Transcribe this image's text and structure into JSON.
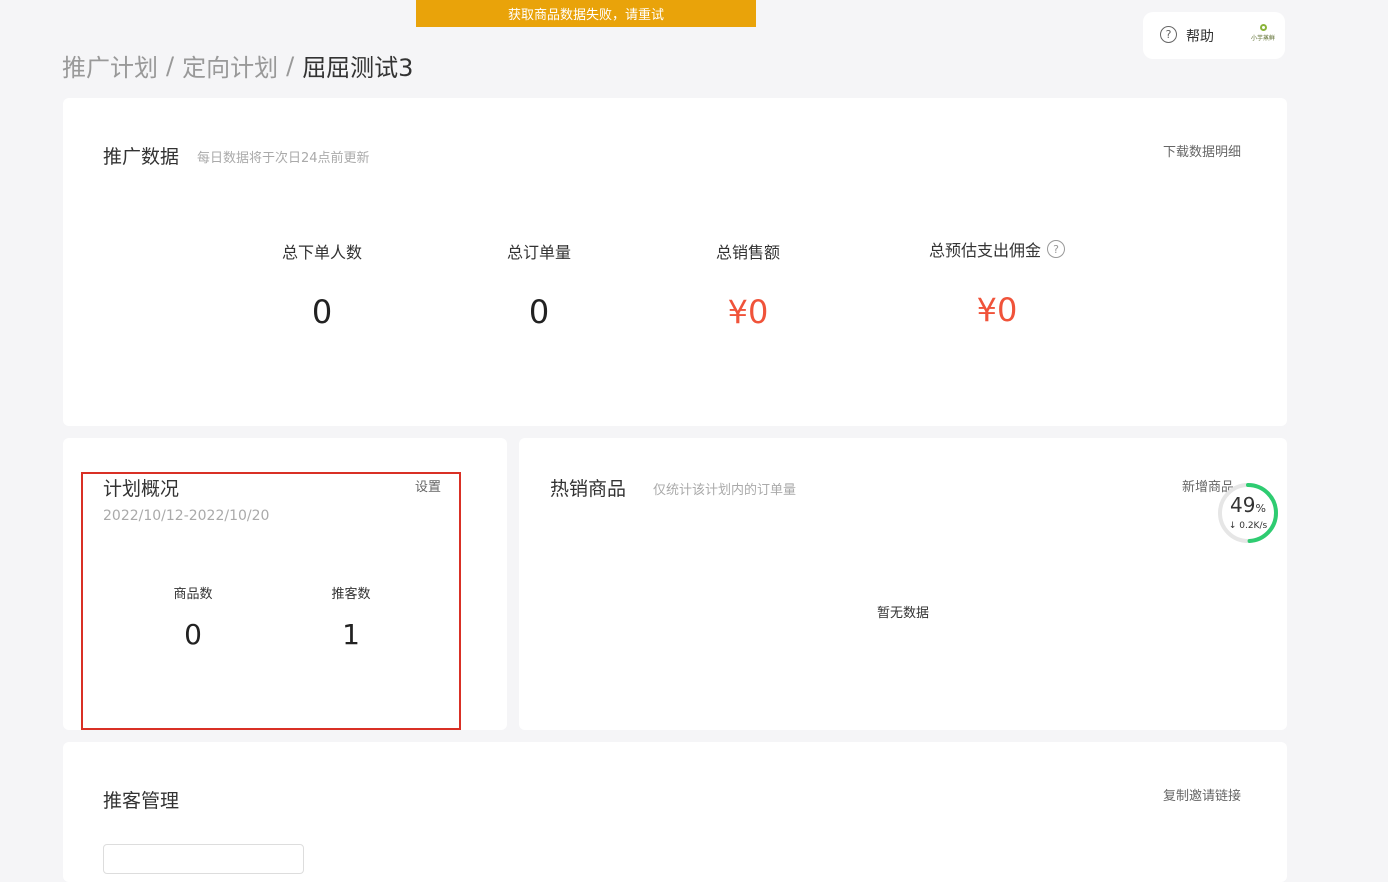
{
  "toast": {
    "message": "获取商品数据失败，请重试"
  },
  "help": {
    "label": "帮助",
    "icon": "question-circle-icon",
    "logo_text": "小芋蒸鲜"
  },
  "breadcrumb": {
    "items": [
      "推广计划",
      "定向计划",
      "屈屈测试3"
    ],
    "separator": "/"
  },
  "promo_data": {
    "title": "推广数据",
    "subtitle": "每日数据将于次日24点前更新",
    "download_link": "下载数据明细",
    "metrics": [
      {
        "label": "总下单人数",
        "value": "0"
      },
      {
        "label": "总订单量",
        "value": "0"
      },
      {
        "label": "总销售额",
        "value": "¥0"
      },
      {
        "label": "总预估支出佣金",
        "value": "¥0"
      }
    ]
  },
  "plan_overview": {
    "title": "计划概况",
    "settings_link": "设置",
    "date_range": "2022/10/12-2022/10/20",
    "stats": [
      {
        "label": "商品数",
        "value": "0"
      },
      {
        "label": "推客数",
        "value": "1"
      }
    ]
  },
  "hot_products": {
    "title": "热销商品",
    "subtitle": "仅统计该计划内的订单量",
    "add_link": "新增商品",
    "empty_text": "暂无数据"
  },
  "progress_widget": {
    "percent": 49,
    "percent_text": "49",
    "percent_unit": "%",
    "speed": "0.2K/s",
    "speed_icon": "arrow-down-icon"
  },
  "promoter_mgmt": {
    "title": "推客管理",
    "copy_link": "复制邀请链接"
  },
  "colors": {
    "toast": "#e9a30a",
    "money": "#f0533a",
    "highlight": "#d93025",
    "progress": "#2ecc71"
  }
}
